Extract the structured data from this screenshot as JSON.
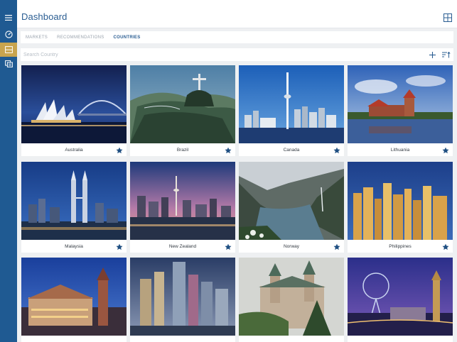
{
  "sidebar": {
    "items": [
      {
        "name": "menu-icon"
      },
      {
        "name": "dashboard-gauge-icon"
      },
      {
        "name": "inbox-tray-icon",
        "active": true
      },
      {
        "name": "reports-icon"
      }
    ]
  },
  "header": {
    "title": "Dashboard",
    "layout_icon": "grid-icon"
  },
  "tabs": [
    {
      "label": "MARKETS",
      "active": false
    },
    {
      "label": "RECOMMENDATIONS",
      "active": false
    },
    {
      "label": "COUNTRIES",
      "active": true
    }
  ],
  "search": {
    "placeholder": "Search Country",
    "value": ""
  },
  "toolbar": {
    "add_icon": "plus-icon",
    "sort_icon": "sort-icon"
  },
  "countries": [
    {
      "name": "Australia",
      "favorite": true
    },
    {
      "name": "Brazil",
      "favorite": true
    },
    {
      "name": "Canada",
      "favorite": true
    },
    {
      "name": "Lithuania",
      "favorite": true
    },
    {
      "name": "Malaysia",
      "favorite": true
    },
    {
      "name": "New Zealand",
      "favorite": true
    },
    {
      "name": "Norway",
      "favorite": true
    },
    {
      "name": "Philippines",
      "favorite": true
    },
    {
      "name": "",
      "favorite": false
    },
    {
      "name": "",
      "favorite": false
    },
    {
      "name": "",
      "favorite": false
    },
    {
      "name": "",
      "favorite": false
    }
  ],
  "colors": {
    "sidebar": "#1f5a92",
    "accent": "#2a5d92",
    "active_sidebar": "#c8a44e",
    "star": "#1f4f82"
  }
}
